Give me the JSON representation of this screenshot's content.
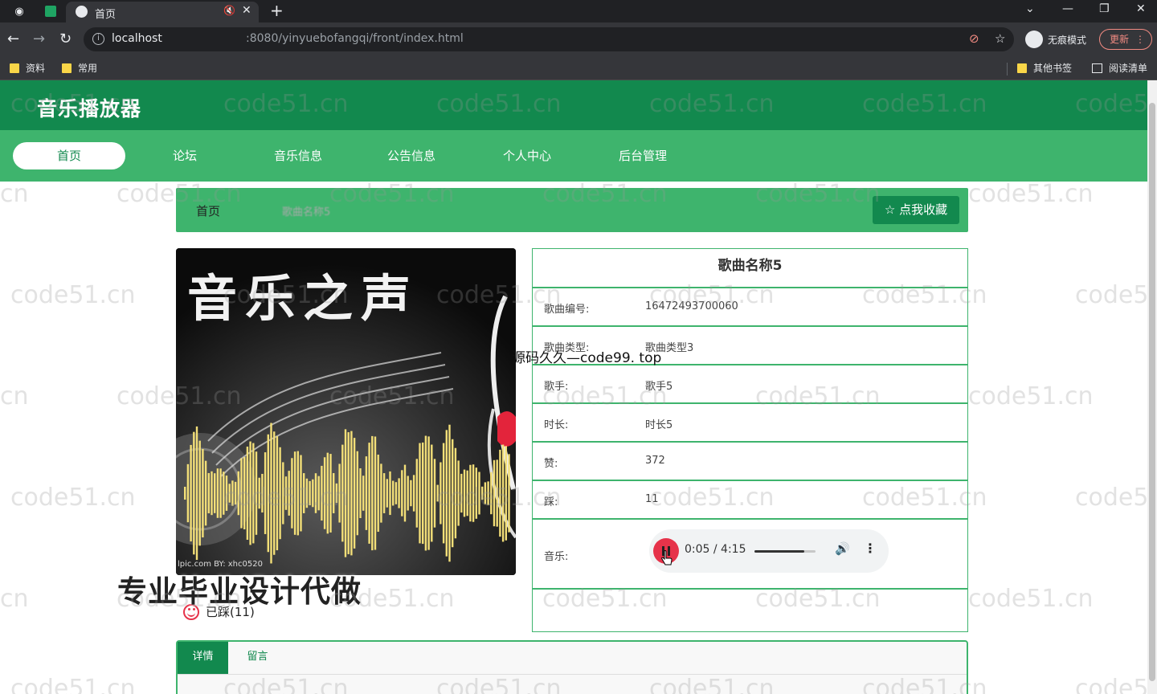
{
  "browser": {
    "tab_title": "首页",
    "url_host": "localhost",
    "url_path": ":8080/yinyuebofangqi/front/index.html",
    "profile_label": "无痕模式",
    "update_label": "更新",
    "bookmarks": [
      "资料",
      "常用"
    ],
    "bookmarks_right": [
      "其他书签",
      "阅读清单"
    ]
  },
  "site": {
    "title": "音乐播放器",
    "nav": [
      "首页",
      "论坛",
      "音乐信息",
      "公告信息",
      "个人中心",
      "后台管理"
    ]
  },
  "breadcrumb": {
    "home": "首页",
    "current": "歌曲名称5",
    "favorite_button": "☆ 点我收藏"
  },
  "cover": {
    "title": "音乐之声",
    "credit": "lpic.com  BY: xhc0520"
  },
  "dislike": {
    "label": "已踩(11)"
  },
  "song": {
    "name": "歌曲名称5",
    "rows": [
      {
        "label": "歌曲编号:",
        "value": "16472493700060"
      },
      {
        "label": "歌曲类型:",
        "value": "歌曲类型3"
      },
      {
        "label": "歌手:",
        "value": "歌手5"
      },
      {
        "label": "时长:",
        "value": "时长5"
      },
      {
        "label": "赞:",
        "value": "372"
      },
      {
        "label": "踩:",
        "value": "11"
      }
    ],
    "music_label": "音乐:"
  },
  "player": {
    "time": "0:05 / 4:15",
    "volume_level": 0.82
  },
  "tabs": [
    "详情",
    "留言"
  ],
  "overlays": {
    "ad_text": "专业毕业设计代做",
    "source_text": "源码久久—code99. top"
  },
  "watermark": "code51.cn",
  "colors": {
    "header_green": "#12894e",
    "nav_green": "#3eb46d",
    "play_red": "#e6334a"
  }
}
